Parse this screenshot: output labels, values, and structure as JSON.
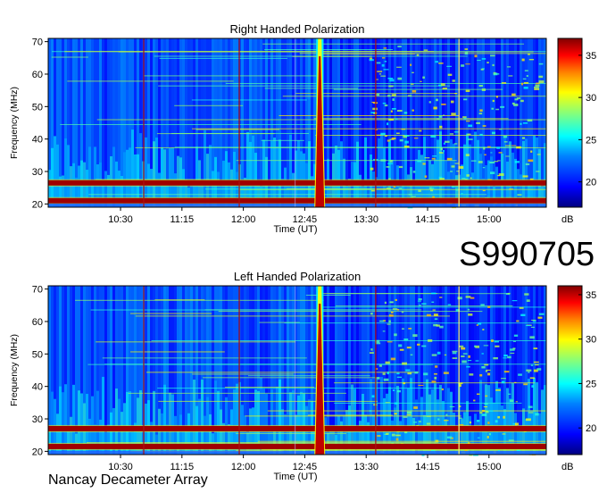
{
  "observation_id": "S990705",
  "instrument": "Nancay Decameter Array",
  "colors": {
    "colormap": [
      "#000080",
      "#0000ff",
      "#0080ff",
      "#00ffff",
      "#80ff80",
      "#ffff00",
      "#ff8000",
      "#ff0000",
      "#800000"
    ],
    "vertical_markers": [
      "#aa1111",
      "#ffff66"
    ]
  },
  "chart_data": [
    {
      "type": "heatmap",
      "title": "Right Handed Polarization",
      "xlabel": "Time (UT)",
      "ylabel": "Frequency (MHz)",
      "x_ticks": [
        "10:30",
        "11:15",
        "12:00",
        "12:45",
        "13:30",
        "14:15",
        "15:00"
      ],
      "x_tick_minutes": [
        630,
        675,
        720,
        765,
        810,
        855,
        900
      ],
      "xlim_minutes": [
        577,
        942
      ],
      "y_ticks": [
        20,
        30,
        40,
        50,
        60,
        70
      ],
      "ylim": [
        19,
        71
      ],
      "colorbar": {
        "label": "dB",
        "ticks": [
          20,
          25,
          30,
          35
        ],
        "range": [
          17,
          37
        ]
      },
      "features": {
        "burst_time_minutes": 776,
        "strong_bands_mhz": [
          21,
          26.5
        ],
        "marker_times_minutes": [
          647,
          717,
          817,
          878
        ],
        "marker_types": [
          "red",
          "red",
          "red",
          "yellow"
        ]
      }
    },
    {
      "type": "heatmap",
      "title": "Left Handed Polarization",
      "xlabel": "Time (UT)",
      "ylabel": "Frequency (MHz)",
      "x_ticks": [
        "10:30",
        "11:15",
        "12:00",
        "12:45",
        "13:30",
        "14:15",
        "15:00"
      ],
      "x_tick_minutes": [
        630,
        675,
        720,
        765,
        810,
        855,
        900
      ],
      "xlim_minutes": [
        577,
        942
      ],
      "y_ticks": [
        20,
        30,
        40,
        50,
        60,
        70
      ],
      "ylim": [
        19,
        71
      ],
      "colorbar": {
        "label": "dB",
        "ticks": [
          20,
          25,
          30,
          35
        ],
        "range": [
          17,
          36
        ]
      },
      "features": {
        "burst_time_minutes": 776,
        "strong_bands_mhz": [
          21.5,
          27
        ],
        "marker_times_minutes": [
          647,
          717,
          817,
          878
        ],
        "marker_types": [
          "red",
          "red",
          "red",
          "yellow"
        ]
      }
    }
  ]
}
